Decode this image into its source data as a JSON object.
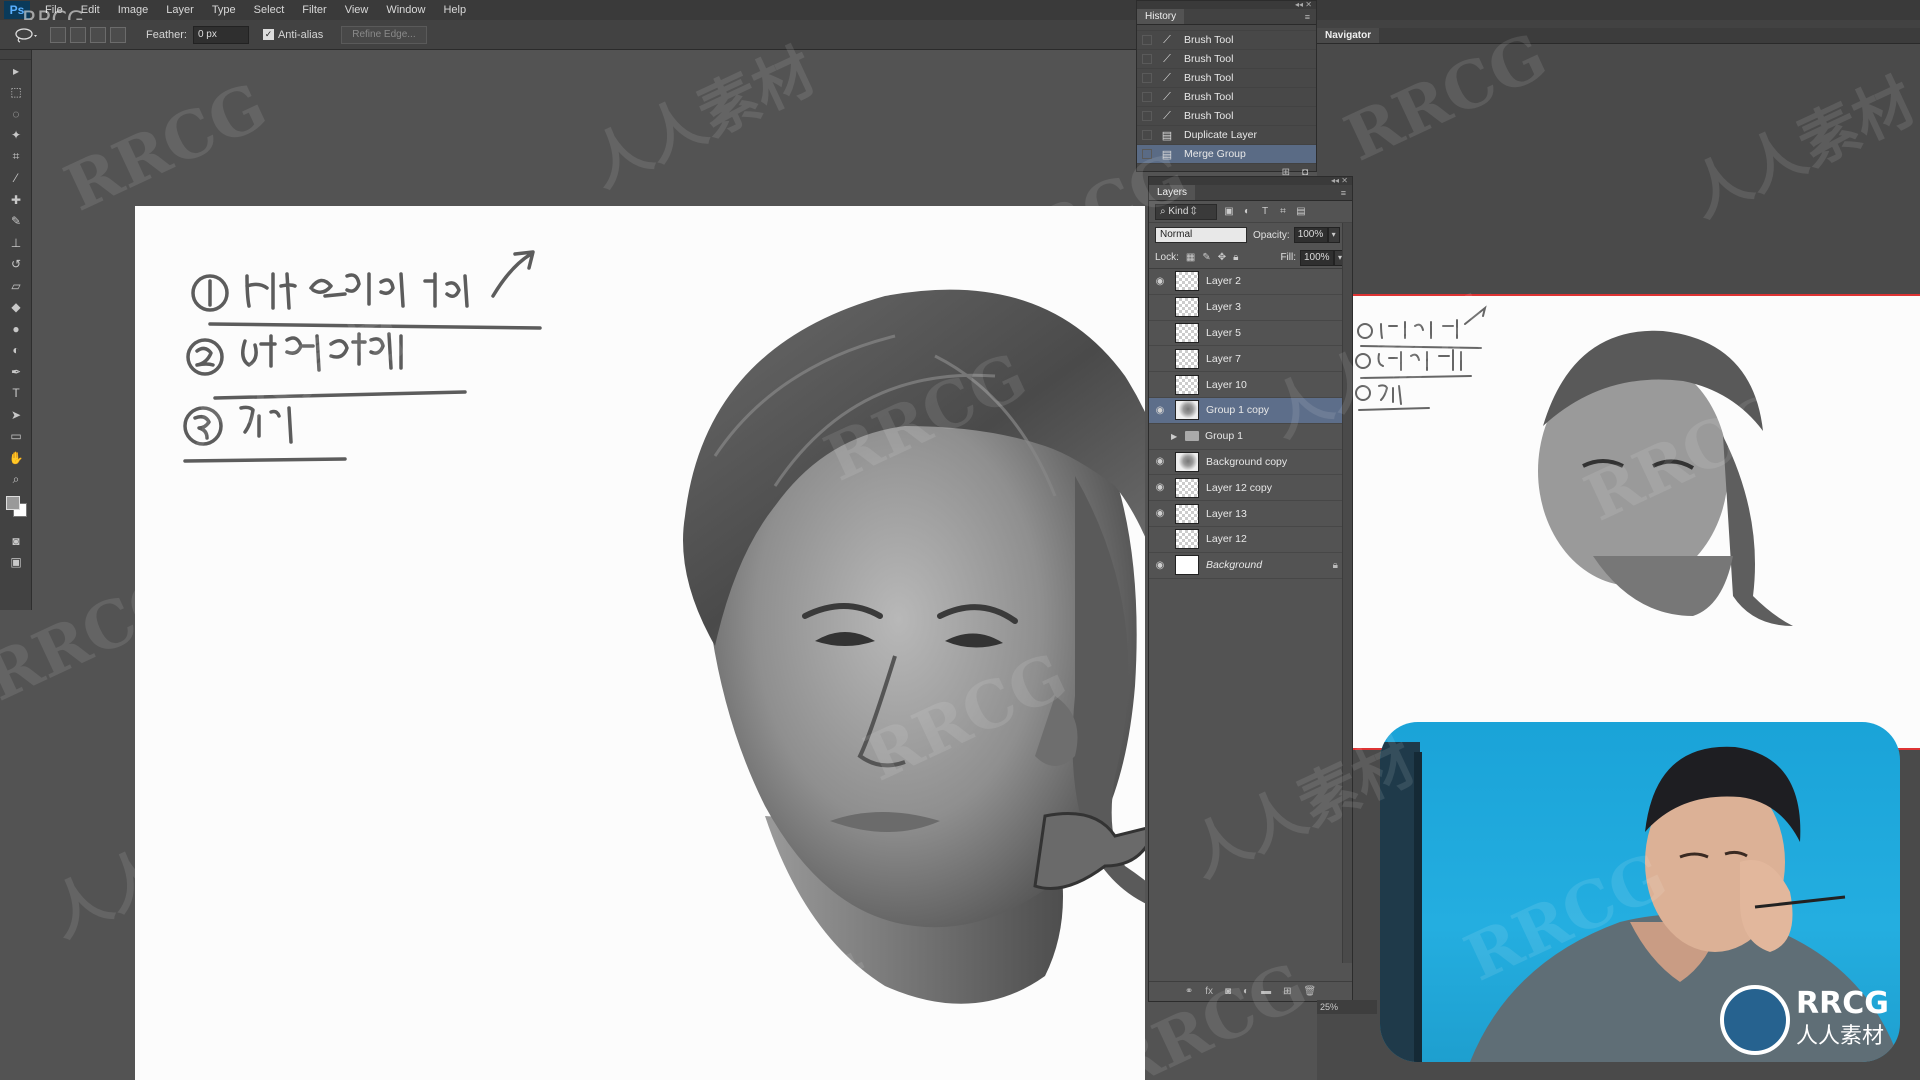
{
  "app": {
    "logo_text": "Ps"
  },
  "menu": [
    "File",
    "Edit",
    "Image",
    "Layer",
    "Type",
    "Select",
    "Filter",
    "View",
    "Window",
    "Help"
  ],
  "options": {
    "feather_label": "Feather:",
    "feather_value": "0 px",
    "antialias_label": "Anti-alias",
    "antialias_checked": true,
    "refine_edge_label": "Refine Edge..."
  },
  "tools": [
    "move-tool-icon",
    "marquee-tool-icon",
    "lasso-tool-icon",
    "magic-wand-icon",
    "crop-tool-icon",
    "eyedropper-icon",
    "healing-brush-icon",
    "brush-tool-icon",
    "clone-stamp-icon",
    "history-brush-icon",
    "eraser-icon",
    "paint-bucket-icon",
    "blur-tool-icon",
    "dodge-tool-icon",
    "pen-tool-icon",
    "type-tool-icon",
    "path-selection-icon",
    "shape-tool-icon",
    "hand-tool-icon",
    "zoom-tool-icon"
  ],
  "history": {
    "tab": "History",
    "items": [
      {
        "label": "Brush Tool",
        "icon": "brush-icon"
      },
      {
        "label": "Brush Tool",
        "icon": "brush-icon"
      },
      {
        "label": "Brush Tool",
        "icon": "brush-icon"
      },
      {
        "label": "Brush Tool",
        "icon": "brush-icon"
      },
      {
        "label": "Brush Tool",
        "icon": "brush-icon"
      },
      {
        "label": "Duplicate Layer",
        "icon": "layer-icon"
      },
      {
        "label": "Merge Group",
        "icon": "layer-icon",
        "selected": true
      }
    ]
  },
  "navigator": {
    "tab": "Navigator",
    "zoom": "25%",
    "frame_color": "#d33333"
  },
  "layers": {
    "tab": "Layers",
    "kind_label": "Kind",
    "blend_mode": "Normal",
    "opacity_label": "Opacity:",
    "opacity_value": "100%",
    "lock_label": "Lock:",
    "fill_label": "Fill:",
    "fill_value": "100%",
    "items": [
      {
        "name": "Layer 2",
        "visible": true,
        "thumb": "transparent"
      },
      {
        "name": "Layer 3",
        "visible": false,
        "thumb": "transparent"
      },
      {
        "name": "Layer 5",
        "visible": false,
        "thumb": "transparent"
      },
      {
        "name": "Layer 7",
        "visible": false,
        "thumb": "transparent"
      },
      {
        "name": "Layer 10",
        "visible": false,
        "thumb": "transparent"
      },
      {
        "name": "Group 1 copy",
        "visible": true,
        "thumb": "image",
        "selected": true
      },
      {
        "name": "Group 1",
        "visible": false,
        "thumb": "folder",
        "is_group": true
      },
      {
        "name": "Background copy",
        "visible": true,
        "thumb": "image"
      },
      {
        "name": "Layer 12 copy",
        "visible": true,
        "thumb": "transparent"
      },
      {
        "name": "Layer 13",
        "visible": true,
        "thumb": "transparent"
      },
      {
        "name": "Layer 12",
        "visible": false,
        "thumb": "transparent"
      },
      {
        "name": "Background",
        "visible": true,
        "thumb": "white",
        "italic": true,
        "locked": true
      }
    ]
  },
  "watermark": {
    "corner_text": "RRCG",
    "logo_text": "RRCG",
    "logo_subtext": "人人素材",
    "tiled_latin": "RRCG",
    "tiled_cjk": "人人素材"
  },
  "colors": {
    "selection_highlight": "#5d6e8a",
    "webcam_bg": "#1aa3d8"
  }
}
